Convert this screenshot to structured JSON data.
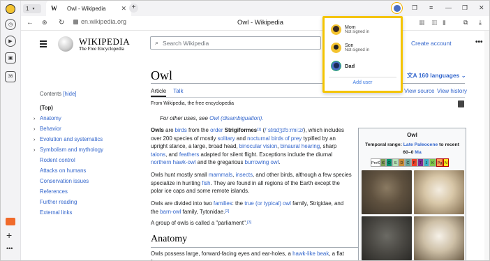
{
  "tab_strip": {
    "tab_count": "1",
    "active_tab": {
      "favicon": "W",
      "title": "Owl - Wikipedia"
    },
    "new_tab": "+",
    "window_controls": [
      "menu-icon",
      "minimize-icon",
      "restore-icon",
      "close-icon"
    ]
  },
  "nav": {
    "address": "en.wikipedia.org",
    "page_title": "Owl - Wikipedia"
  },
  "profiles": {
    "items": [
      {
        "name": "Mom",
        "status": "Not signed in"
      },
      {
        "name": "Son",
        "status": "Not signed in"
      },
      {
        "name": "Dad",
        "status": ""
      }
    ],
    "add_user": "Add user"
  },
  "wiki": {
    "wordmark": "WIKIPEDIA",
    "tagline": "The Free Encyclopedia",
    "search_placeholder": "Search Wikipedia",
    "create_account": "Create account",
    "title": "Owl",
    "languages": "160 languages",
    "tab_article": "Article",
    "tab_talk": "Talk",
    "tab_view_source": "View source",
    "tab_view_history": "View history",
    "from": "From Wikipedia, the free encyclopedia",
    "hatnote_pre": "For other uses, see ",
    "hatnote_link": "Owl (disambiguation).",
    "toc": {
      "heading": "Contents",
      "hide": "[hide]",
      "items": [
        {
          "label": "(Top)",
          "chevron": false
        },
        {
          "label": "Anatomy",
          "chevron": true
        },
        {
          "label": "Behavior",
          "chevron": true
        },
        {
          "label": "Evolution and systematics",
          "chevron": true
        },
        {
          "label": "Symbolism and mythology",
          "chevron": true
        },
        {
          "label": "Rodent control",
          "chevron": false
        },
        {
          "label": "Attacks on humans",
          "chevron": false
        },
        {
          "label": "Conservation issues",
          "chevron": false
        },
        {
          "label": "References",
          "chevron": false
        },
        {
          "label": "Further reading",
          "chevron": false
        },
        {
          "label": "External links",
          "chevron": false
        }
      ]
    },
    "p1": {
      "b1": "Owls",
      "t1": " are ",
      "l1": "birds",
      "t2": " from the ",
      "l2": "order",
      "t3": " ",
      "b2": "Strigiformes",
      "sup1": "[1]",
      "t4": " (",
      "ipa": "/ˈstrɪdʒɪfɔːrmiːz/",
      "t5": "), which includes over 200 species of mostly ",
      "l3": "solitary",
      "t6": " and ",
      "l4": "nocturnal birds of prey",
      "t7": " typified by an upright stance, a large, broad head, ",
      "l5": "binocular vision",
      "t8": ", ",
      "l6": "binaural hearing",
      "t9": ", sharp ",
      "l7": "talons",
      "t10": ", and ",
      "l8": "feathers",
      "t11": " adapted for silent flight. Exceptions include the diurnal ",
      "l9": "northern hawk-owl",
      "t12": " and the gregarious ",
      "l10": "burrowing owl",
      "t13": "."
    },
    "p2": {
      "t1": "Owls hunt mostly small ",
      "l1": "mammals",
      "t2": ", ",
      "l2": "insects",
      "t3": ", and other birds, although a few species specialize in hunting ",
      "l3": "fish",
      "t4": ". They are found in all regions of the Earth except the polar ice caps and some remote islands."
    },
    "p3": {
      "t1": "Owls are divided into two ",
      "l1": "families",
      "t2": ": the ",
      "l2": "true (or typical) owl",
      "t3": " family, Strigidae, and the ",
      "l3": "barn-owl",
      "t4": " family, Tytonidae.",
      "sup": "[2]"
    },
    "p4": {
      "t1": "A group of owls is called a \"parliament\".",
      "sup": "[3]"
    },
    "h2": "Anatomy",
    "p5": {
      "t1": "Owls possess large, forward-facing eyes and ear-holes, a ",
      "l1": "hawk-like",
      "t2": " ",
      "l2": "beak",
      "t3": ", a flat face,"
    },
    "infobox": {
      "title": "Owl",
      "range_label": "Temporal range: ",
      "range_link": "Late Paleocene",
      "range_tail": " to recent",
      "range2": "60–0 ",
      "range2_link": "Ma",
      "chrono": [
        "PreЄ",
        "Є",
        "O",
        "S",
        "D",
        "C",
        "P",
        "T",
        "J",
        "K",
        "Pg",
        "N"
      ]
    }
  }
}
